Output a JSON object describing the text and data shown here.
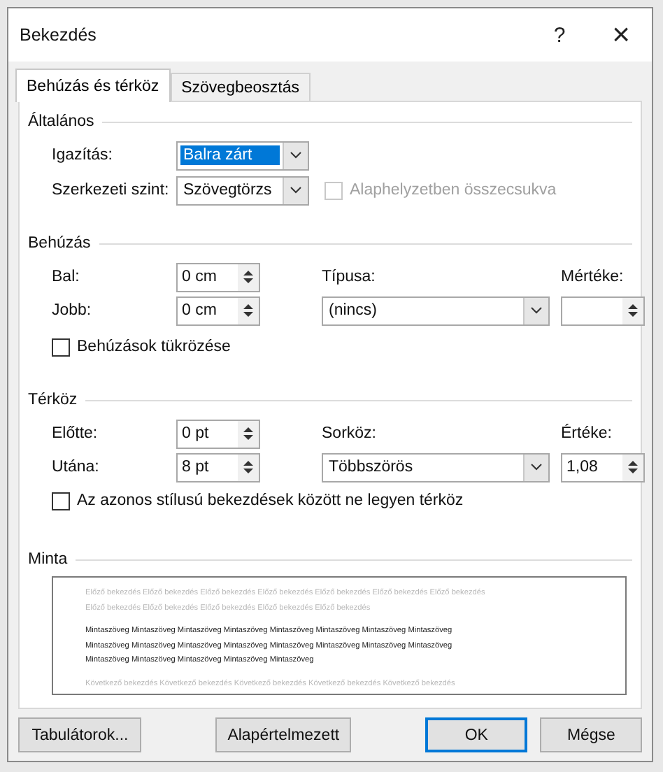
{
  "window": {
    "title": "Bekezdés",
    "help": "?",
    "close": "×"
  },
  "tabs": [
    {
      "label": "Behúzás és térköz",
      "selected": true
    },
    {
      "label": "Szövegbeosztás",
      "selected": false
    }
  ],
  "general": {
    "title": "Általános",
    "alignment": {
      "label": "Igazítás:",
      "value": "Balra zárt",
      "selected": true
    },
    "outline": {
      "label": "Szerkezeti szint:",
      "value": "Szövegtörzs",
      "selected": false
    },
    "collapsed": {
      "label": "Alaphelyzetben összecsukva",
      "checked": false,
      "disabled": true
    }
  },
  "indent": {
    "title": "Behúzás",
    "left": {
      "label": "Bal:",
      "value": "0 cm"
    },
    "right": {
      "label": "Jobb:",
      "value": "0 cm"
    },
    "type": {
      "label": "Típusa:",
      "value": "(nincs)"
    },
    "amount": {
      "label": "Mértéke:"
    },
    "mirror": {
      "label": "Behúzások tükrözése",
      "checked": false
    }
  },
  "spacing": {
    "title": "Térköz",
    "before": {
      "label": "Előtte:",
      "value": "0 pt"
    },
    "after": {
      "label": "Utána:",
      "value": "8 pt"
    },
    "line": {
      "label": "Sorköz:",
      "value": "Többszörös"
    },
    "at": {
      "label": "Értéke:",
      "value": "1,08"
    },
    "nospace": {
      "label": "Az azonos stílusú bekezdések között ne legyen térköz",
      "checked": false
    }
  },
  "preview": {
    "title": "Minta",
    "previous": [
      "Előző bekezdés Előző bekezdés Előző bekezdés Előző bekezdés Előző bekezdés Előző bekezdés Előző bekezdés",
      "Előző bekezdés Előző bekezdés Előző bekezdés Előző bekezdés Előző bekezdés"
    ],
    "sample": [
      "Mintaszöveg Mintaszöveg Mintaszöveg Mintaszöveg Mintaszöveg Mintaszöveg Mintaszöveg Mintaszöveg",
      "Mintaszöveg Mintaszöveg Mintaszöveg Mintaszöveg Mintaszöveg Mintaszöveg Mintaszöveg Mintaszöveg",
      "Mintaszöveg Mintaszöveg Mintaszöveg Mintaszöveg Mintaszöveg"
    ],
    "next": [
      "Következő bekezdés Következő bekezdés Következő bekezdés Következő bekezdés Következő bekezdés"
    ]
  },
  "buttons": [
    {
      "label": "Tabulátorok...",
      "default": false
    },
    {
      "label": "Alapértelmezett",
      "default": false
    },
    {
      "label": "OK",
      "default": true
    },
    {
      "label": "Mégse",
      "default": false
    }
  ]
}
